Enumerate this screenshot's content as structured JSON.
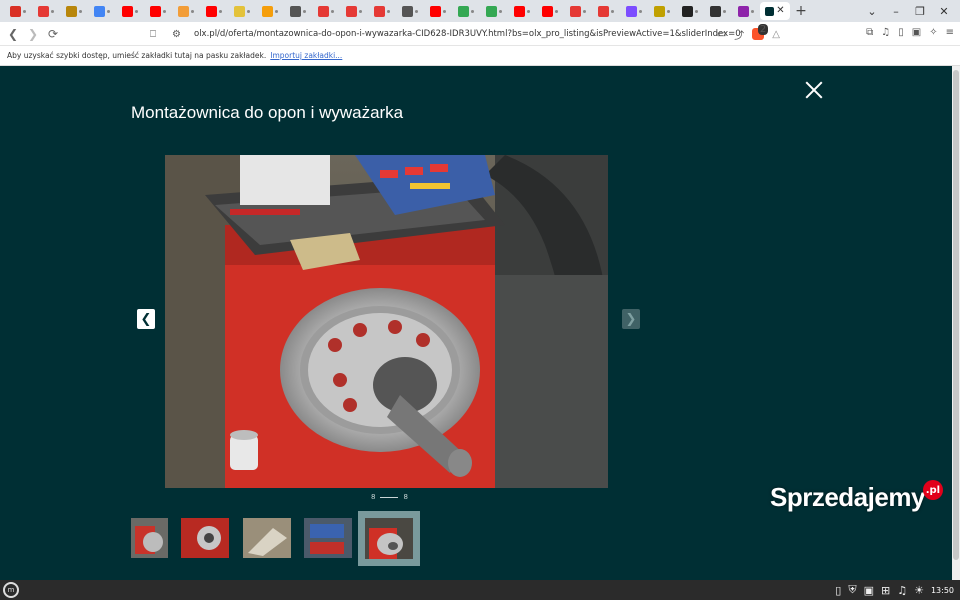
{
  "browser": {
    "tabs": [
      {
        "icon": "gmail-icon",
        "color": "#d93025"
      },
      {
        "icon": "red-s-icon",
        "color": "#e53935"
      },
      {
        "icon": "news-icon",
        "color": "#b8860b"
      },
      {
        "icon": "google-icon",
        "color": "#4285f4"
      },
      {
        "icon": "youtube-icon",
        "color": "#ff0000"
      },
      {
        "icon": "youtube-icon",
        "color": "#ff0000"
      },
      {
        "icon": "amazon-icon",
        "color": "#f29d38"
      },
      {
        "icon": "youtube-icon",
        "color": "#ff0000"
      },
      {
        "icon": "g-icon",
        "color": "#e3c23a"
      },
      {
        "icon": "orange-icon",
        "color": "#f59e0b"
      },
      {
        "icon": "globe-icon",
        "color": "#555555"
      },
      {
        "icon": "gift-icon",
        "color": "#e53935"
      },
      {
        "icon": "gift-icon",
        "color": "#e53935"
      },
      {
        "icon": "gift-icon",
        "color": "#e53935"
      },
      {
        "icon": "globe-icon",
        "color": "#555555"
      },
      {
        "icon": "youtube-icon",
        "color": "#ff0000"
      },
      {
        "icon": "maps-icon",
        "color": "#34a853"
      },
      {
        "icon": "maps-icon",
        "color": "#34a853"
      },
      {
        "icon": "youtube-icon",
        "color": "#ff0000"
      },
      {
        "icon": "youtube-icon",
        "color": "#ff0000"
      },
      {
        "icon": "gsm-icon",
        "color": "#e53935"
      },
      {
        "icon": "gsm-icon",
        "color": "#e53935"
      },
      {
        "icon": "headset-icon",
        "color": "#7c4dff"
      },
      {
        "icon": "shield-icon",
        "color": "#c0a000"
      },
      {
        "icon": "dark-circle-icon",
        "color": "#222222"
      },
      {
        "icon": "edge-icon",
        "color": "#333333"
      },
      {
        "icon": "purple-icon",
        "color": "#8e24aa"
      }
    ],
    "active_tab_icon": "olx-icon",
    "active_tab_close": "✕",
    "new_tab": "+",
    "url": "olx.pl/d/oferta/montazownica-do-opon-i-wywazarka-CID628-IDR3UVY.html?bs=olx_pro_listing&isPreviewActive=1&sliderIndex=0",
    "bookmarks_message": "Aby uzyskać szybki dostęp, umieść zakładki tutaj na pasku zakładek.",
    "bookmarks_link": "Importuj zakładki...",
    "brave_count": "2"
  },
  "gallery": {
    "title": "Montażownica do opon i wyważarka",
    "counter_current": "8",
    "counter_total": "8",
    "watermark_text": "Sprzedajemy",
    "watermark_badge": ".pl"
  },
  "taskbar": {
    "clock": "13:50"
  }
}
